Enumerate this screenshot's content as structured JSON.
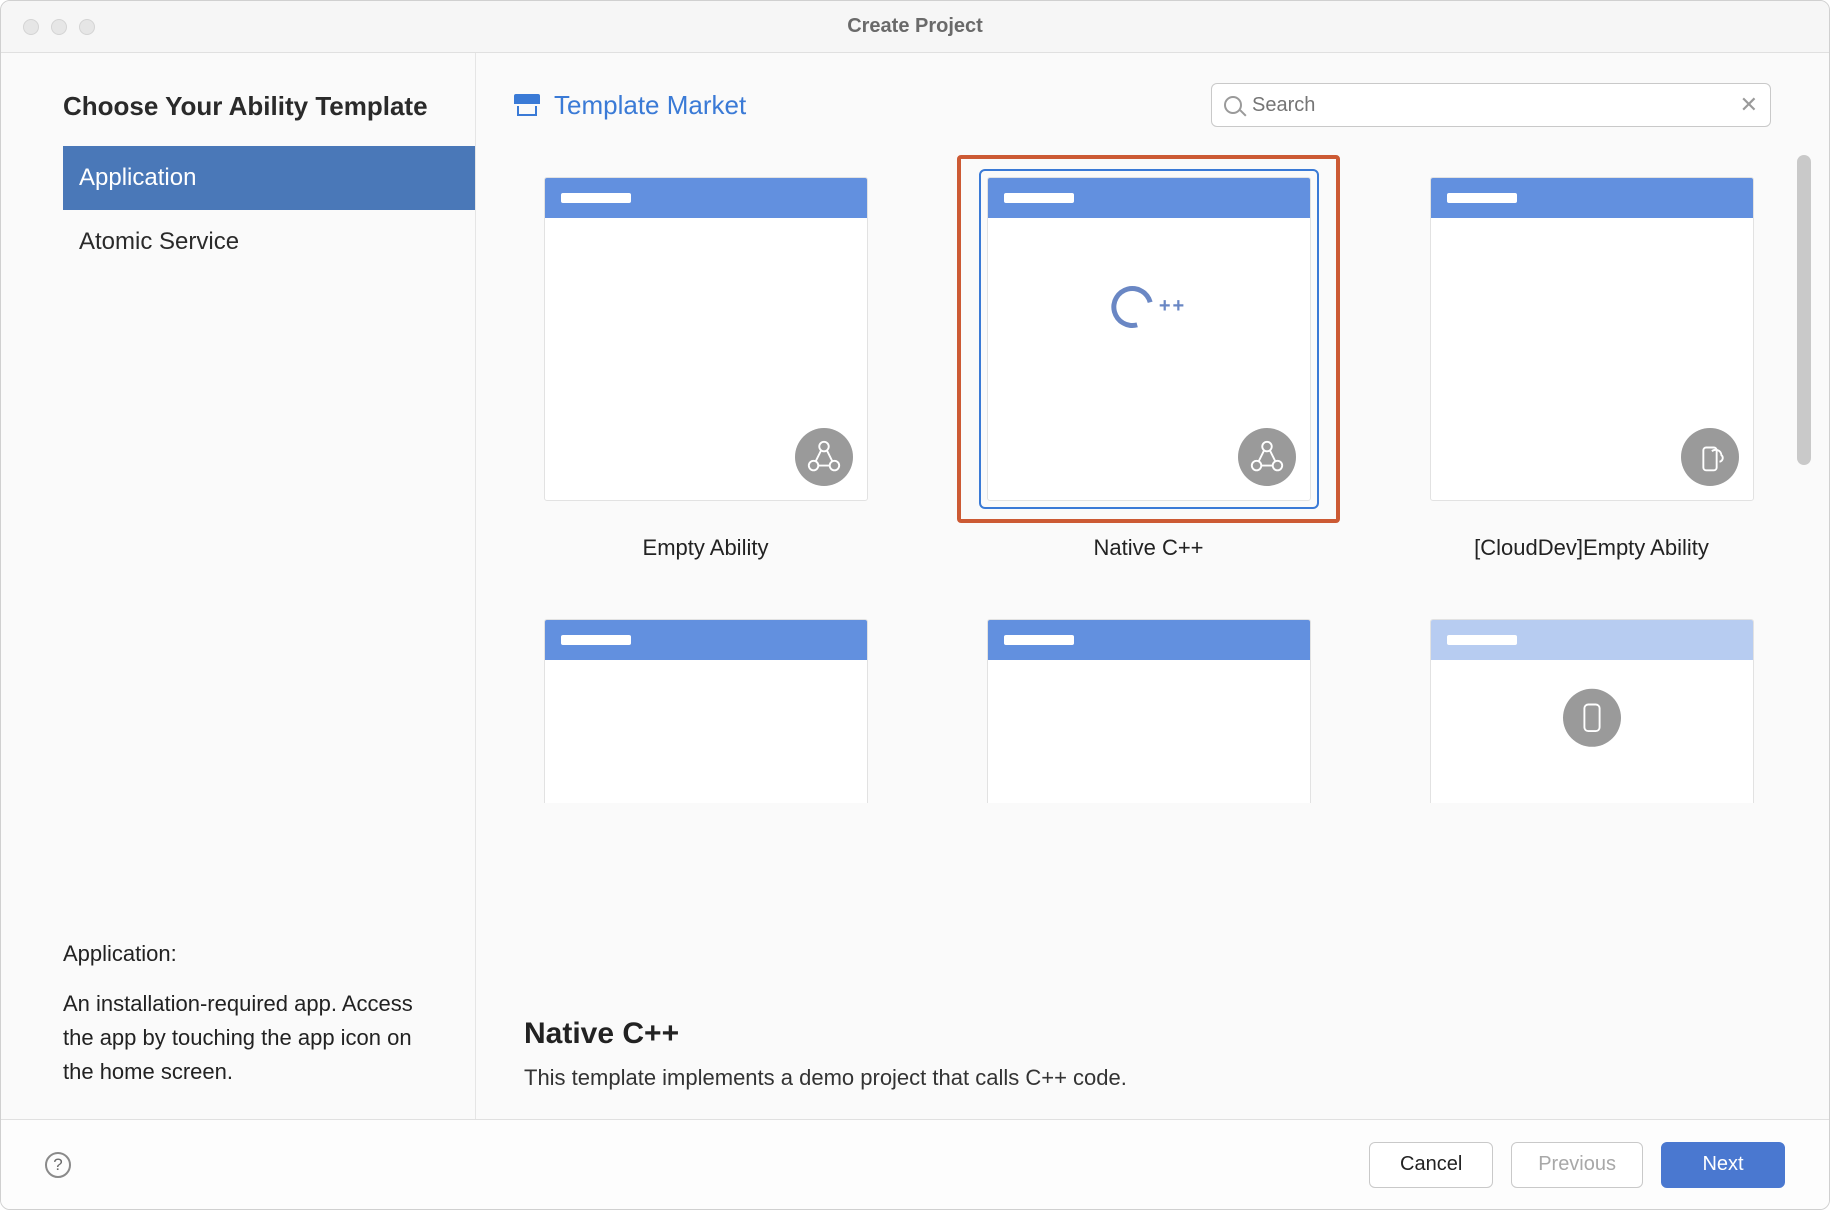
{
  "window": {
    "title": "Create Project"
  },
  "sidebar": {
    "heading": "Choose Your Ability Template",
    "items": [
      {
        "label": "Application",
        "active": true
      },
      {
        "label": "Atomic Service",
        "active": false
      }
    ],
    "description": {
      "title": "Application:",
      "text": "An installation-required app. Access the app by touching the app icon on the home screen."
    }
  },
  "header": {
    "market_label": "Template Market",
    "search_placeholder": "Search"
  },
  "templates": [
    {
      "label": "Empty Ability",
      "icon": "network",
      "selected": false,
      "highlight": false,
      "bar": "normal"
    },
    {
      "label": "Native C++",
      "icon": "network",
      "selected": true,
      "highlight": true,
      "bar": "normal",
      "center": "cpp"
    },
    {
      "label": "[CloudDev]Empty Ability",
      "icon": "cloud",
      "selected": false,
      "highlight": false,
      "bar": "normal"
    }
  ],
  "templates_row2_bars": [
    "normal",
    "normal",
    "light"
  ],
  "templates_row2_phone_index": 2,
  "detail": {
    "title": "Native C++",
    "text": "This template implements a demo project that calls C++ code."
  },
  "footer": {
    "help": "?",
    "cancel": "Cancel",
    "previous": "Previous",
    "next": "Next"
  }
}
